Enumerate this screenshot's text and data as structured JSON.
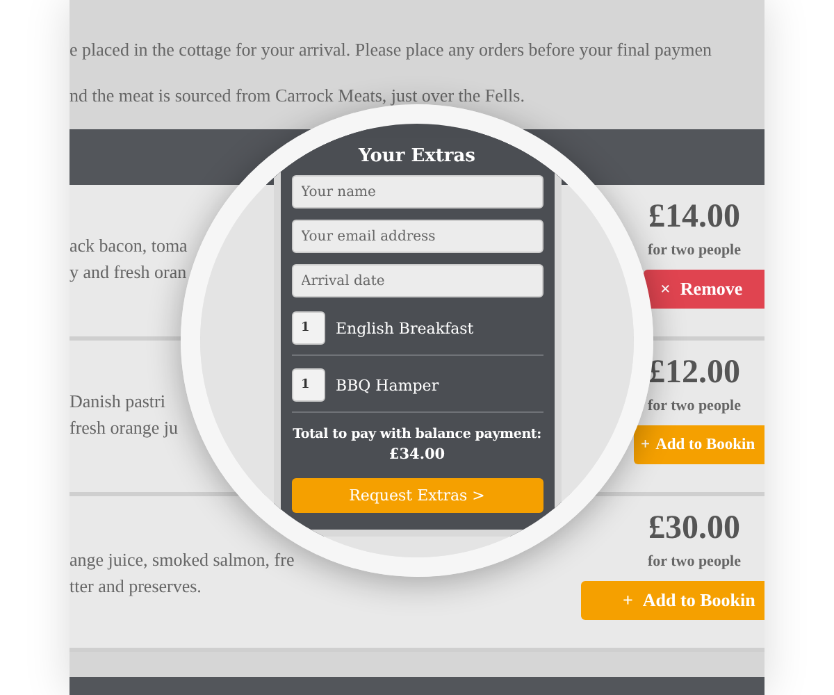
{
  "intro_paragraphs": [
    "e placed in the cottage for your arrival. Please place any orders before your final paymen",
    "nd the meat is sourced from Carrock Meats, just over the Fells."
  ],
  "products": [
    {
      "description_lines": [
        "ack bacon, toma",
        "y and fresh oran"
      ],
      "price": "£14.00",
      "price_note": "for two people",
      "action": {
        "kind": "remove",
        "icon": "×",
        "label": "Remove"
      }
    },
    {
      "description_lines": [
        "Danish pastri",
        "fresh orange ju"
      ],
      "price": "£12.00",
      "price_note": "for two people",
      "action": {
        "kind": "add",
        "icon": "+",
        "label": "Add to Bookin"
      }
    },
    {
      "description_lines": [
        "ange juice, smoked salmon, fre",
        "tter and preserves."
      ],
      "price": "£30.00",
      "price_note": "for two people",
      "action": {
        "kind": "add",
        "icon": "+",
        "label": "Add to Bookin"
      }
    }
  ],
  "extras_panel": {
    "title": "Your Extras",
    "fields": [
      {
        "placeholder": "Your name"
      },
      {
        "placeholder": "Your email address"
      },
      {
        "placeholder": "Arrival date"
      }
    ],
    "items": [
      {
        "quantity": "1",
        "name": "English Breakfast"
      },
      {
        "quantity": "1",
        "name": "BBQ Hamper"
      }
    ],
    "total_label": "Total to pay with balance payment:",
    "total": "£34.00",
    "button": "Request Extras >"
  }
}
